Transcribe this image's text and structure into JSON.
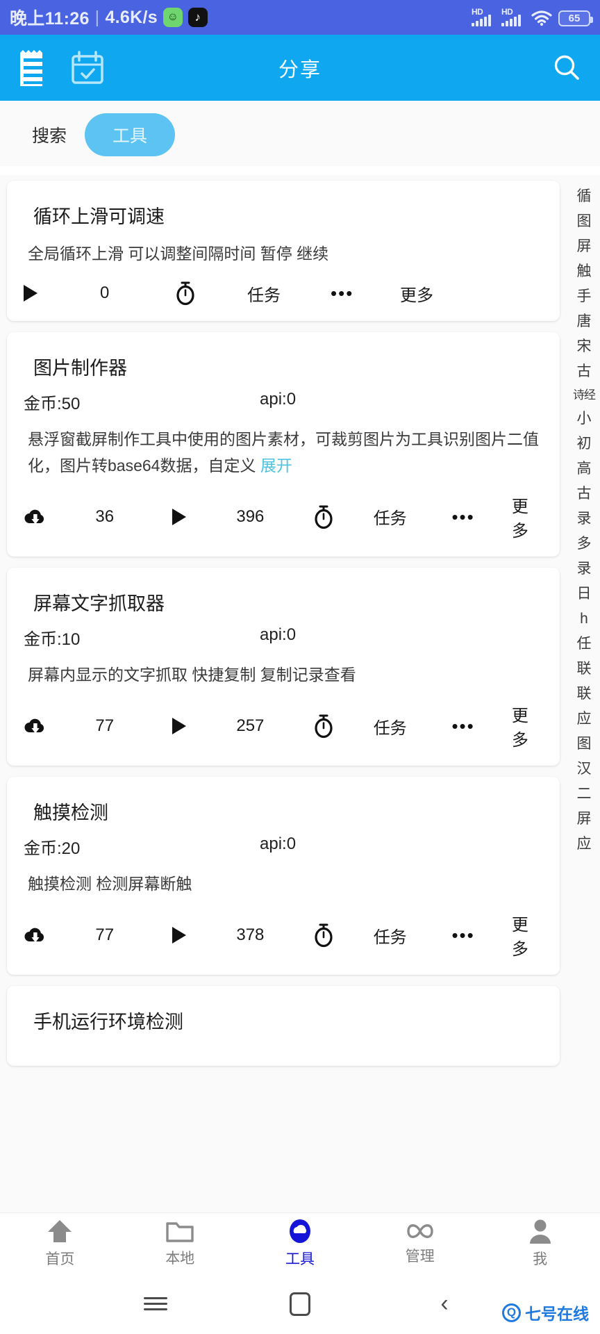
{
  "statusbar": {
    "time": "晚上11:26",
    "separator": "|",
    "netspeed": "4.6K/s",
    "app_icon_1": "android-green-icon",
    "app_icon_2": "tiktok-icon",
    "hd_label_1": "HD",
    "hd_label_2": "HD",
    "wifi_icon": "wifi-icon",
    "battery": "65"
  },
  "appbar": {
    "menu_icon": "receipt-list-icon",
    "calendar_icon": "calendar-check-icon",
    "title": "分享",
    "search_icon": "search-icon"
  },
  "tabs": {
    "search_label": "搜索",
    "tools_label": "工具",
    "active": "工具",
    "active_bg": "#5cc3f2"
  },
  "cards": [
    {
      "title": "循环上滑可调速",
      "coin": "",
      "api": "",
      "desc": "全局循环上滑 可以调整间隔时间 暂停 继续",
      "expand": "",
      "has_download": false,
      "downloads": "",
      "plays": "0",
      "task_label": "任务",
      "more_dots": "•••",
      "more_label": "更多"
    },
    {
      "title": "图片制作器",
      "coin": "金币:50",
      "api": "api:0",
      "desc": "悬浮窗截屏制作工具中使用的图片素材，可裁剪图片为工具识别图片二值化，图片转base64数据，自定义 ",
      "expand": "展开",
      "has_download": true,
      "downloads": "36",
      "plays": "396",
      "task_label": "任务",
      "more_dots": "•••",
      "more_label": "更多"
    },
    {
      "title": "屏幕文字抓取器",
      "coin": "金币:10",
      "api": "api:0",
      "desc": "屏幕内显示的文字抓取 快捷复制 复制记录查看",
      "expand": "",
      "has_download": true,
      "downloads": "77",
      "plays": "257",
      "task_label": "任务",
      "more_dots": "•••",
      "more_label": "更多"
    },
    {
      "title": "触摸检测",
      "coin": "金币:20",
      "api": "api:0",
      "desc": "触摸检测 检测屏幕断触",
      "expand": "",
      "has_download": true,
      "downloads": "77",
      "plays": "378",
      "task_label": "任务",
      "more_dots": "•••",
      "more_label": "更多"
    },
    {
      "title": "手机运行环境检测",
      "coin": "",
      "api": "",
      "desc": "",
      "expand": "",
      "has_download": false,
      "downloads": "",
      "plays": "",
      "task_label": "",
      "more_dots": "",
      "more_label": ""
    }
  ],
  "index_letters": [
    "循",
    "图",
    "屏",
    "触",
    "手",
    "唐",
    "宋",
    "古",
    "诗经",
    "小",
    "初",
    "高",
    "古",
    "录",
    "多",
    "录",
    "日",
    "h",
    "任",
    "联",
    "联",
    "应",
    "图",
    "汉",
    "二",
    "屏",
    "应"
  ],
  "bottom_nav": [
    {
      "label": "首页",
      "icon": "home-icon",
      "active": false
    },
    {
      "label": "本地",
      "icon": "folder-icon",
      "active": false
    },
    {
      "label": "工具",
      "icon": "cloud-tools-icon",
      "active": true
    },
    {
      "label": "管理",
      "icon": "infinity-icon",
      "active": false
    },
    {
      "label": "我",
      "icon": "person-icon",
      "active": false
    }
  ],
  "android_nav": {
    "recents_icon": "hamburger-recents-icon",
    "home_icon": "home-square-icon",
    "back_icon": "back-chevron-icon"
  },
  "watermark": {
    "mark": "Q",
    "text": "七号在线"
  },
  "colors": {
    "statusbar": "#4a63e0",
    "appbar": "#0fa8f0",
    "accent": "#5cc3f2",
    "active_nav": "#1515d8",
    "link": "#4ec3e0"
  }
}
